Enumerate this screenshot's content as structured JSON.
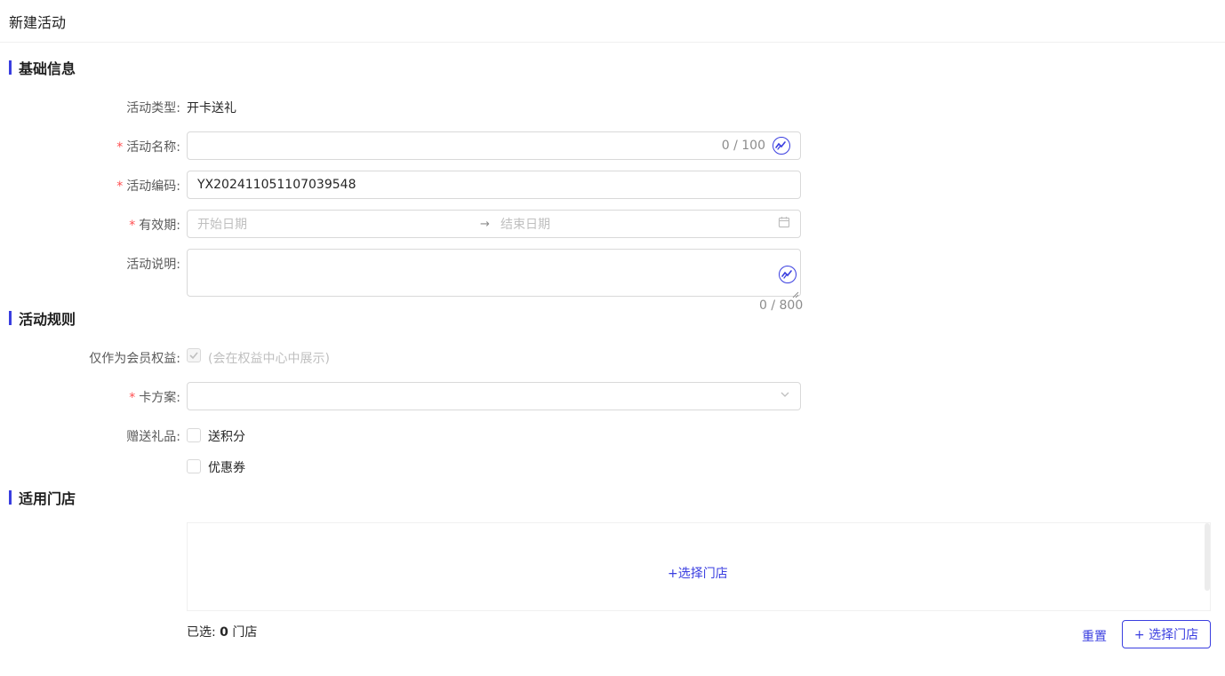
{
  "header": {
    "title": "新建活动"
  },
  "sections": {
    "basic": "基础信息",
    "rules": "活动规则",
    "stores": "适用门店"
  },
  "form": {
    "type_label": "活动类型:",
    "type_value": "开卡送礼",
    "name_label": "活动名称:",
    "name_value": "",
    "name_count": "0 / 100",
    "code_label": "活动编码:",
    "code_value": "YX202411051107039548",
    "period_label": "有效期:",
    "start_placeholder": "开始日期",
    "end_placeholder": "结束日期",
    "desc_label": "活动说明:",
    "desc_count": "0 / 800",
    "member_label": "仅作为会员权益:",
    "member_hint": "(会在权益中心中展示)",
    "card_label": "卡方案:",
    "gift_label": "赠送礼品:",
    "gift_points": "送积分",
    "gift_coupon": "优惠券",
    "required_mark": "*"
  },
  "stores": {
    "select_link": "+选择门店",
    "selected_prefix": "已选:",
    "selected_count": "0",
    "selected_suffix": "门店",
    "reset_button": "重置",
    "select_button": "+ 选择门店"
  },
  "colors": {
    "accent": "#3a3ee0",
    "required": "#ff4d4f"
  }
}
